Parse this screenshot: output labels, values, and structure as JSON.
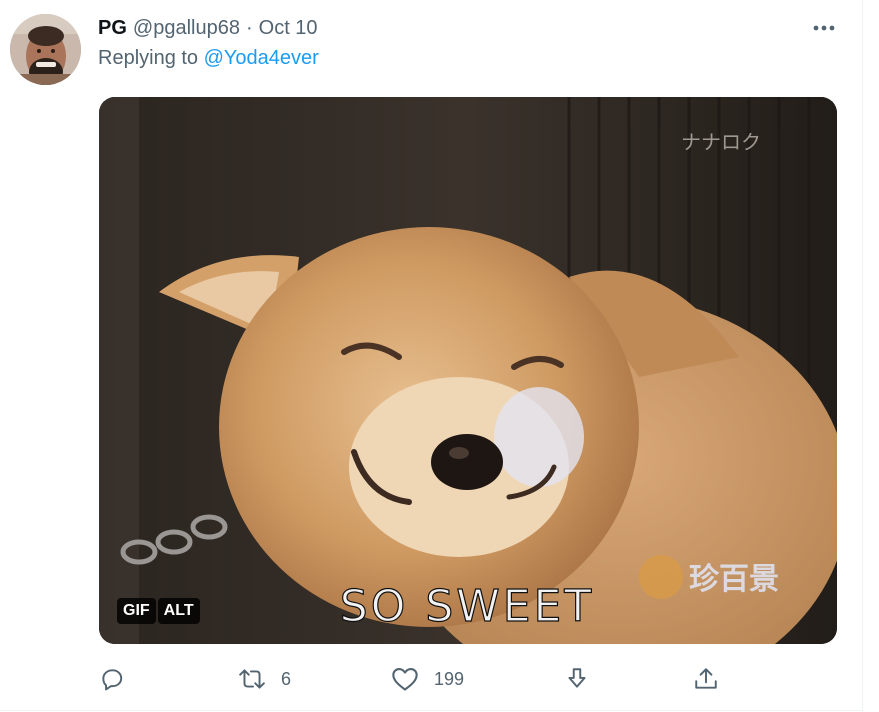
{
  "tweet": {
    "author_name": "PG",
    "handle": "@pgallup68",
    "separator": "·",
    "date": "Oct 10",
    "replying_prefix": "Replying to",
    "replying_handle": "@Yoda4ever",
    "more_icon": "more-horizontal-icon"
  },
  "media": {
    "type": "GIF",
    "caption": "SO SWEET",
    "watermark_top": "ナナロク",
    "watermark_bottom": "珍百景",
    "badges": [
      "GIF",
      "ALT"
    ]
  },
  "actions": [
    {
      "name": "reply",
      "icon": "reply-icon",
      "count": ""
    },
    {
      "name": "retweet",
      "icon": "retweet-icon",
      "count": "6"
    },
    {
      "name": "like",
      "icon": "heart-icon",
      "count": "199"
    },
    {
      "name": "save",
      "icon": "download-icon",
      "count": ""
    },
    {
      "name": "share",
      "icon": "share-icon",
      "count": ""
    }
  ],
  "colors": {
    "text": "#0f1419",
    "secondary": "#536471",
    "link": "#1d9bf0",
    "divider": "#eff3f4"
  }
}
